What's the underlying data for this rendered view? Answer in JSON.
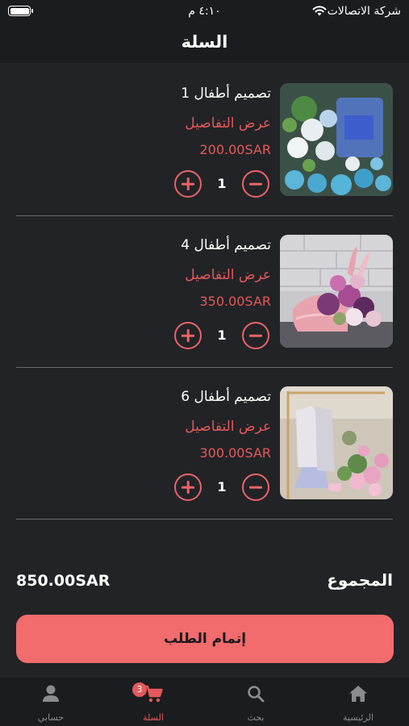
{
  "status_bar": {
    "carrier": "شركة الاتصالات",
    "time": "٤:١٠ م"
  },
  "header": {
    "title": "السلة"
  },
  "cart": {
    "items": [
      {
        "name": "تصميم أطفال 1",
        "details_label": "عرض التفاصيل",
        "price": "200.00SAR",
        "quantity": "1",
        "image": "blue-white-flower-arrangement"
      },
      {
        "name": "تصميم أطفال 4",
        "details_label": "عرض التفاصيل",
        "price": "350.00SAR",
        "quantity": "1",
        "image": "pink-stroller-flower-arrangement"
      },
      {
        "name": "تصميم أطفال 6",
        "details_label": "عرض التفاصيل",
        "price": "300.00SAR",
        "quantity": "1",
        "image": "baby-dress-flower-arrangement"
      }
    ]
  },
  "summary": {
    "total_label": "المجموع",
    "total_value": "850.00SAR"
  },
  "checkout": {
    "label": "إتمام الطلب"
  },
  "tab_bar": {
    "tabs": [
      {
        "label": "الرئيسية",
        "icon": "home-icon"
      },
      {
        "label": "بحث",
        "icon": "search-icon"
      },
      {
        "label": "السلة",
        "icon": "cart-icon",
        "badge": "3",
        "active": true
      },
      {
        "label": "حسابي",
        "icon": "person-icon"
      }
    ]
  },
  "colors": {
    "background": "#222326",
    "accent": "#e3595c",
    "button": "#f26b6d"
  }
}
